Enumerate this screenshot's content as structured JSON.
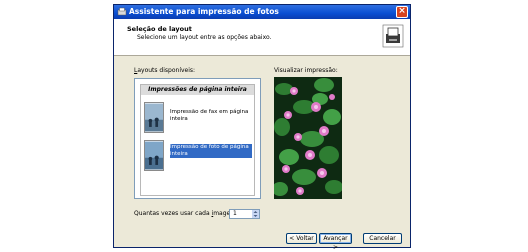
{
  "window": {
    "title": "Assistente para impressão de fotos"
  },
  "header": {
    "title": "Seleção de layout",
    "subtitle": "Selecione um layout entre as opções abaixo."
  },
  "layouts": {
    "label_prefix": "",
    "label_u": "L",
    "label_rest": "ayouts disponíveis:",
    "group_title": "Impressões de página inteira",
    "items": [
      {
        "label": "Impressão de fax em página inteira",
        "selected": false
      },
      {
        "label": "Impressão de foto de página inteira",
        "selected": true
      }
    ]
  },
  "preview": {
    "label": "Visualizar impressão:"
  },
  "copies": {
    "label_prefix": "Quantas vezes usar cada ",
    "label_u": "i",
    "label_rest": "magem:",
    "value": "1"
  },
  "buttons": {
    "back": "< Voltar",
    "next": "Avançar >",
    "cancel": "Cancelar"
  }
}
